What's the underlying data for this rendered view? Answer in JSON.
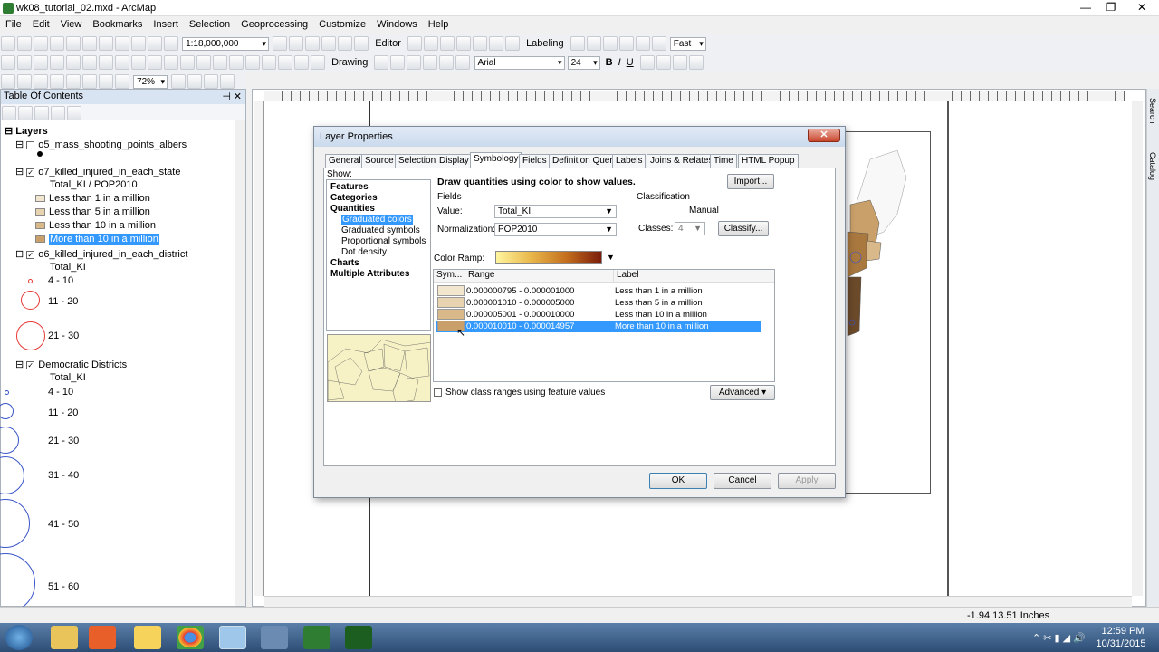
{
  "app": {
    "title": "wk08_tutorial_02.mxd - ArcMap"
  },
  "menu": [
    "File",
    "Edit",
    "View",
    "Bookmarks",
    "Insert",
    "Selection",
    "Geoprocessing",
    "Customize",
    "Windows",
    "Help"
  ],
  "toolbar": {
    "scale": "1:18,000,000",
    "editor": "Editor",
    "labeling": "Labeling",
    "quality": "Fast",
    "drawing": "Drawing",
    "font": "Arial",
    "font_size": "24",
    "bold": "B",
    "italic": "I",
    "underline": "U",
    "zoom": "72%"
  },
  "toc": {
    "title": "Table Of Contents",
    "root": "Layers",
    "layers": [
      {
        "name": "o5_mass_shooting_points_albers"
      },
      {
        "name": "o7_killed_injured_in_each_state",
        "field": "Total_KI / POP2010",
        "classes": [
          "Less than 1 in a million",
          "Less than 5 in a million",
          "Less than 10 in a million",
          "More than 10 in a million"
        ]
      },
      {
        "name": "o6_killed_injured_in_each_district",
        "field": "Total_KI",
        "classes": [
          "4 - 10",
          "11 - 20",
          "21 - 30"
        ]
      },
      {
        "name": "Democratic Districts",
        "field": "Total_KI",
        "classes": [
          "4 - 10",
          "11 - 20",
          "21 - 30",
          "31 - 40",
          "41 - 50",
          "51 - 60"
        ]
      }
    ],
    "colors": {
      "c1": "#f2e6cf",
      "c2": "#e8d3b0",
      "c3": "#d9b98a",
      "c4": "#c9a06a"
    }
  },
  "dialog": {
    "title": "Layer Properties",
    "tabs": [
      "General",
      "Source",
      "Selection",
      "Display",
      "Symbology",
      "Fields",
      "Definition Query",
      "Labels",
      "Joins & Relates",
      "Time",
      "HTML Popup"
    ],
    "active_tab": "Symbology",
    "show_label": "Show:",
    "show_items": [
      "Features",
      "Categories",
      "Quantities",
      "Graduated colors",
      "Graduated symbols",
      "Proportional symbols",
      "Dot density",
      "Charts",
      "Multiple Attributes"
    ],
    "heading": "Draw quantities using color to show values.",
    "import": "Import...",
    "fields_label": "Fields",
    "value_label": "Value:",
    "value": "Total_KI",
    "normalization_label": "Normalization:",
    "normalization": "POP2010",
    "classification_label": "Classification",
    "method": "Manual",
    "classes_label": "Classes:",
    "classes": "4",
    "classify": "Classify...",
    "color_ramp_label": "Color Ramp:",
    "table_headers": {
      "sym": "Sym...",
      "range": "Range",
      "label": "Label"
    },
    "rows": [
      {
        "range": "0.000000795 - 0.000001000",
        "label": "Less than 1 in a million",
        "color": "#f2e6cf"
      },
      {
        "range": "0.000001010 - 0.000005000",
        "label": "Less than 5 in a million",
        "color": "#e8d3b0"
      },
      {
        "range": "0.000005001 - 0.000010000",
        "label": "Less than 10 in a million",
        "color": "#d9b98a"
      },
      {
        "range": "0.000010010 - 0.000014957",
        "label": "More than 10 in a million",
        "color": "#c9a06a"
      }
    ],
    "show_ranges": "Show class ranges using feature values",
    "advanced": "Advanced",
    "ok": "OK",
    "cancel": "Cancel",
    "apply": "Apply"
  },
  "status": {
    "coords": "-1.94  13.51 Inches"
  },
  "clock": {
    "time": "12:59 PM",
    "date": "10/31/2015"
  }
}
